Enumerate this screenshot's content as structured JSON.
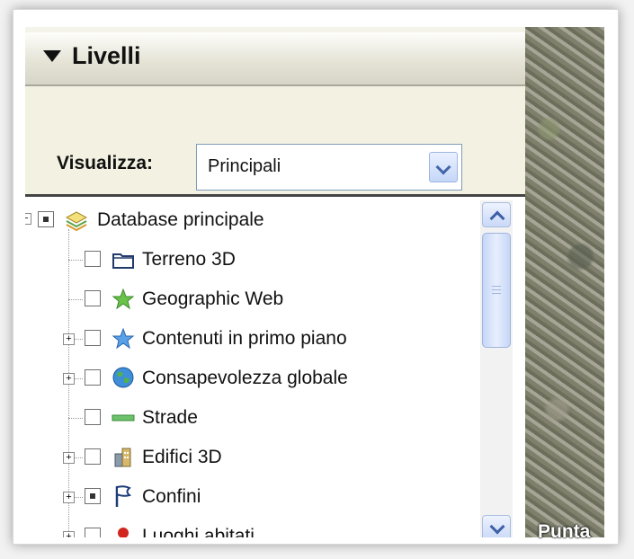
{
  "panel": {
    "title": "Livelli",
    "visualizza_label": "Visualizza:",
    "select_value": "Principali"
  },
  "tree": {
    "items": [
      {
        "label": "Database principale",
        "icon": "layers-icon",
        "checkbox": "partial",
        "expander": "minus"
      },
      {
        "label": "Terreno 3D",
        "icon": "folder-icon",
        "checkbox": "unchecked",
        "expander": "none"
      },
      {
        "label": "Geographic Web",
        "icon": "green-star-icon",
        "checkbox": "unchecked",
        "expander": "none"
      },
      {
        "label": "Contenuti in primo piano",
        "icon": "blue-star-icon",
        "checkbox": "unchecked",
        "expander": "plus"
      },
      {
        "label": "Consapevolezza globale",
        "icon": "globe-icon",
        "checkbox": "unchecked",
        "expander": "plus"
      },
      {
        "label": "Strade",
        "icon": "road-icon",
        "checkbox": "unchecked",
        "expander": "none"
      },
      {
        "label": "Edifici 3D",
        "icon": "buildings-icon",
        "checkbox": "unchecked",
        "expander": "plus"
      },
      {
        "label": "Confini",
        "icon": "border-flag-icon",
        "checkbox": "partial",
        "expander": "plus"
      },
      {
        "label": "Luoghi abitati",
        "icon": "pin-icon",
        "checkbox": "unchecked",
        "expander": "plus"
      }
    ]
  },
  "map": {
    "label": "Punta"
  }
}
